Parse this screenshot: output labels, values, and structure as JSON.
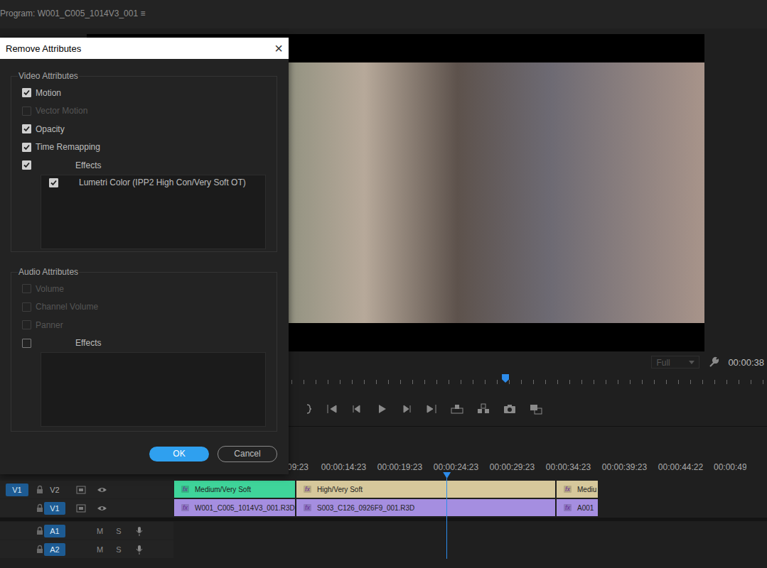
{
  "monitor": {
    "title": "Program: W001_C005_1014V3_001",
    "menu_icon": "≡",
    "zoom": "Full",
    "timecode": "00:00:38",
    "playhead": 0.45
  },
  "dialog": {
    "title": "Remove Attributes",
    "close": "×",
    "groups": [
      {
        "label": "Video Attributes",
        "items": [
          {
            "kind": "check",
            "label": "Motion",
            "checked": true,
            "disabled": false
          },
          {
            "kind": "check",
            "label": "Vector Motion",
            "checked": false,
            "disabled": true
          },
          {
            "kind": "check",
            "label": "Opacity",
            "checked": true,
            "disabled": false
          },
          {
            "kind": "check",
            "label": "Time Remapping",
            "checked": true,
            "disabled": false
          },
          {
            "kind": "effects",
            "label": "Effects",
            "checked": true,
            "disabled": false,
            "effects": [
              {
                "label": "Lumetri Color (IPP2 High Con/Very Soft OT)",
                "checked": true
              }
            ]
          }
        ]
      },
      {
        "label": "Audio Attributes",
        "items": [
          {
            "kind": "check",
            "label": "Volume",
            "checked": false,
            "disabled": true
          },
          {
            "kind": "check",
            "label": "Channel Volume",
            "checked": false,
            "disabled": true
          },
          {
            "kind": "check",
            "label": "Panner",
            "checked": false,
            "disabled": true
          },
          {
            "kind": "effects",
            "label": "Effects",
            "checked": false,
            "disabled": false,
            "effects": []
          }
        ]
      }
    ],
    "buttons": [
      {
        "label": "OK",
        "primary": true
      },
      {
        "label": "Cancel",
        "primary": false
      }
    ]
  },
  "timeline": {
    "ruler": [
      "09:23",
      "00:00:14:23",
      "00:00:19:23",
      "00:00:24:23",
      "00:00:29:23",
      "00:00:34:23",
      "00:00:39:23",
      "00:00:44:22",
      "00:00:49"
    ],
    "playhead": 0.476,
    "tracks": [
      {
        "kind": "video",
        "source": "V1",
        "source_selected": true,
        "name": "V2",
        "targeted": false,
        "clips": [
          {
            "label": "Medium/Very Soft",
            "fx": "fx",
            "color": "#3fd49a"
          },
          {
            "label": "High/Very Soft",
            "fx": "fx",
            "color": "#d6c89b"
          },
          {
            "label": "Mediu",
            "fx": "fx",
            "color": "#d6c89b"
          }
        ]
      },
      {
        "kind": "video",
        "source": "",
        "source_selected": false,
        "name": "V1",
        "targeted": true,
        "clips": [
          {
            "label": "W001_C005_1014V3_001.R3D",
            "fx": "fx",
            "color": "#a58ee0"
          },
          {
            "label": "S003_C126_0926F9_001.R3D",
            "fx": "fx",
            "color": "#a58ee0"
          },
          {
            "label": "A001",
            "fx": "fx",
            "color": "#a58ee0"
          }
        ]
      },
      {
        "kind": "audio",
        "source": "",
        "source_selected": false,
        "name": "A1",
        "targeted": true,
        "mute": "M",
        "solo": "S",
        "clips": []
      },
      {
        "kind": "audio",
        "source": "",
        "source_selected": false,
        "name": "A2",
        "targeted": true,
        "mute": "M",
        "solo": "S",
        "clips": []
      }
    ]
  }
}
